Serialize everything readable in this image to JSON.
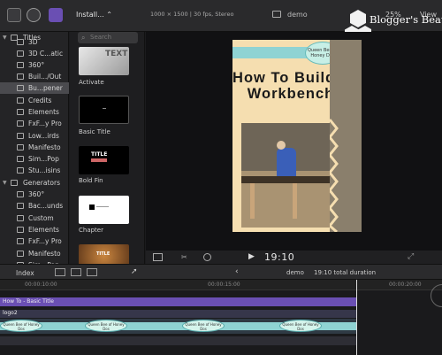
{
  "toolbar": {
    "installed_label": "Install... ⌃",
    "format_text": "1000 × 1500 | 30 fps, Stereo",
    "project_name": "demo",
    "zoom": "25%",
    "view": "View"
  },
  "sidebar": {
    "items": [
      {
        "label": "Titles",
        "arrow": "▼"
      },
      {
        "label": "3D",
        "arrow": ""
      },
      {
        "label": "3D C...atic",
        "arrow": ""
      },
      {
        "label": "360°",
        "arrow": ""
      },
      {
        "label": "Buil.../Out",
        "arrow": ""
      },
      {
        "label": "Bu...pener",
        "arrow": ""
      },
      {
        "label": "Credits",
        "arrow": ""
      },
      {
        "label": "Elements",
        "arrow": ""
      },
      {
        "label": "FxF...y Pro",
        "arrow": ""
      },
      {
        "label": "Low...irds",
        "arrow": ""
      },
      {
        "label": "Manifesto",
        "arrow": ""
      },
      {
        "label": "Sim...Pop",
        "arrow": ""
      },
      {
        "label": "Stu...isins",
        "arrow": ""
      },
      {
        "label": "Generators",
        "arrow": "▼"
      },
      {
        "label": "360°",
        "arrow": ""
      },
      {
        "label": "Bac...unds",
        "arrow": ""
      },
      {
        "label": "Custom",
        "arrow": ""
      },
      {
        "label": "Elements",
        "arrow": ""
      },
      {
        "label": "FxF...y Pro",
        "arrow": ""
      },
      {
        "label": "Manifesto",
        "arrow": ""
      },
      {
        "label": "Sim...Pop",
        "arrow": ""
      }
    ]
  },
  "browser": {
    "search_placeholder": "Search",
    "thumbnails": [
      {
        "label": "Activate",
        "text": "TEXT"
      },
      {
        "label": "Basic Title",
        "text": ""
      },
      {
        "label": "Bold Fin",
        "text": "TITLE"
      },
      {
        "label": "Chapter",
        "text": ""
      },
      {
        "label": "",
        "text": "TITLE"
      }
    ]
  },
  "viewer": {
    "book_title": "How To Build a Workbench",
    "badge_text": "Queen Bee of Honey Dos",
    "timecode": "19:10"
  },
  "timeline": {
    "index_label": "Index",
    "project_name": "demo",
    "duration_text": "19:10 total duration",
    "ruler": [
      "00:00:10:00",
      "00:00:15:00",
      "00:00:20:00"
    ],
    "tracks": [
      {
        "label": "How To - Basic Title"
      },
      {
        "label": "logo2"
      }
    ],
    "logo_text": "Queen Bee of Honey Dos"
  },
  "watermark": {
    "text": "Blogger's Beat"
  },
  "colors": {
    "accent_purple": "#6a4fb3",
    "logo_teal": "#8fd3d3",
    "book_bg": "#f5deb0"
  }
}
